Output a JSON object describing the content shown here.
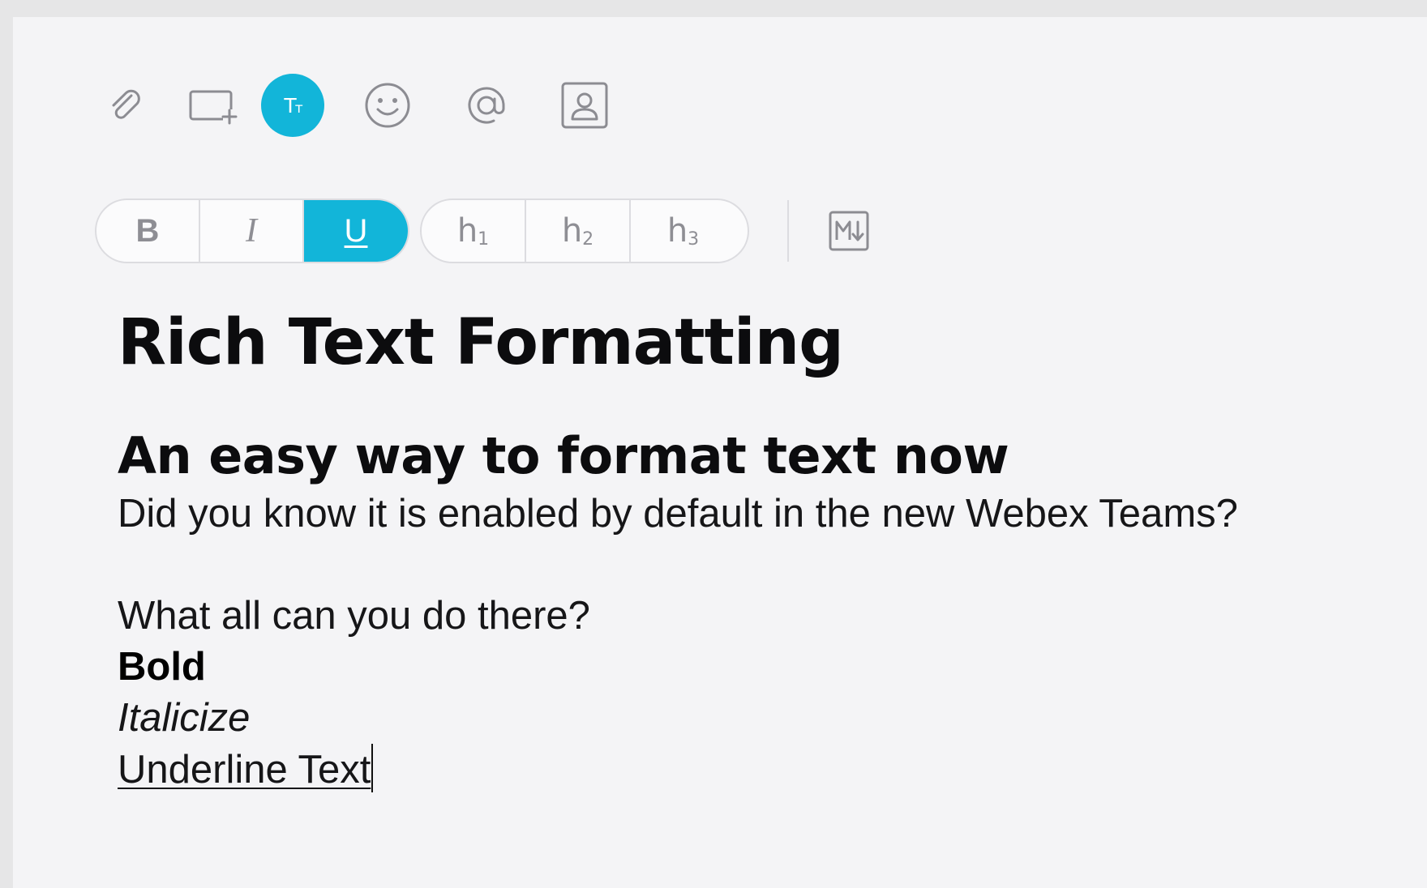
{
  "action_bar": {
    "items": [
      {
        "name": "attach",
        "icon": "paperclip-icon"
      },
      {
        "name": "share-screen",
        "icon": "screen-share-icon"
      },
      {
        "name": "text-format",
        "icon": "text-format-icon",
        "label": "Tт",
        "active": true
      },
      {
        "name": "emoji",
        "icon": "smiley-icon"
      },
      {
        "name": "mention",
        "icon": "at-sign-icon"
      },
      {
        "name": "contact",
        "icon": "contact-card-icon"
      }
    ],
    "active_color": "#12b5d9"
  },
  "format_toolbar": {
    "style_buttons": [
      {
        "label": "B",
        "name": "bold",
        "active": false
      },
      {
        "label": "I",
        "name": "italic",
        "active": false
      },
      {
        "label": "U",
        "name": "underline",
        "active": true
      }
    ],
    "heading_buttons": [
      {
        "label": "h",
        "sub": "1",
        "name": "heading-1"
      },
      {
        "label": "h",
        "sub": "2",
        "name": "heading-2"
      },
      {
        "label": "h",
        "sub": "3",
        "name": "heading-3"
      }
    ],
    "markdown_icon": "markdown-icon"
  },
  "composer": {
    "heading1": "Rich Text Formatting",
    "heading2": "An easy way to format text now",
    "line1": "Did you know it is enabled by default in the new Webex Teams?",
    "line2": "What all can you do there?",
    "bold_text": "Bold",
    "italic_text": "Italicize",
    "underline_text": "Underline Text"
  }
}
